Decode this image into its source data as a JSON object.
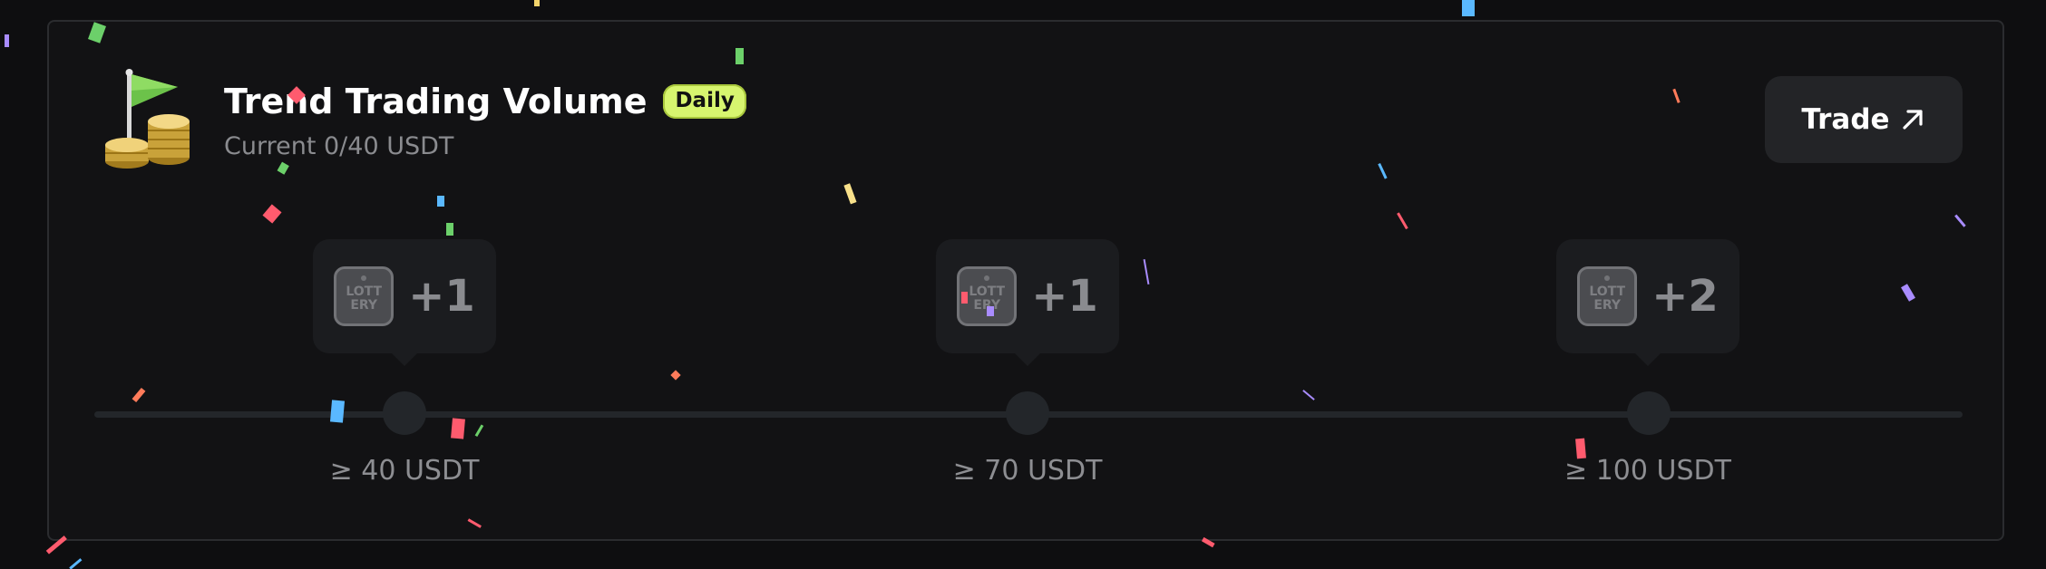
{
  "task": {
    "title": "Trend Trading Volume",
    "badge": "Daily",
    "progress_text": "Current 0/40 USDT",
    "icon": "flag-coins-icon",
    "trade_button": {
      "label": "Trade",
      "icon": "arrow-up-right-icon"
    }
  },
  "milestones": [
    {
      "reward_icon": "lottery-ticket-icon",
      "ticket_text_line1": "LOTT",
      "ticket_text_line2": "ERY",
      "reward_count": "+1",
      "threshold_label": "≥ 40 USDT"
    },
    {
      "reward_icon": "lottery-ticket-icon",
      "ticket_text_line1": "LOTT",
      "ticket_text_line2": "ERY",
      "reward_count": "+1",
      "threshold_label": "≥ 70 USDT"
    },
    {
      "reward_icon": "lottery-ticket-icon",
      "ticket_text_line1": "LOTT",
      "ticket_text_line2": "ERY",
      "reward_count": "+2",
      "threshold_label": "≥ 100 USDT"
    }
  ],
  "progress": {
    "current": 0,
    "target": 40,
    "fraction": 0
  },
  "colors": {
    "background": "#0e0e10",
    "card": "#121214",
    "badge": "#d7f56f",
    "muted_text": "#8a8b8f",
    "track": "#23262a"
  }
}
